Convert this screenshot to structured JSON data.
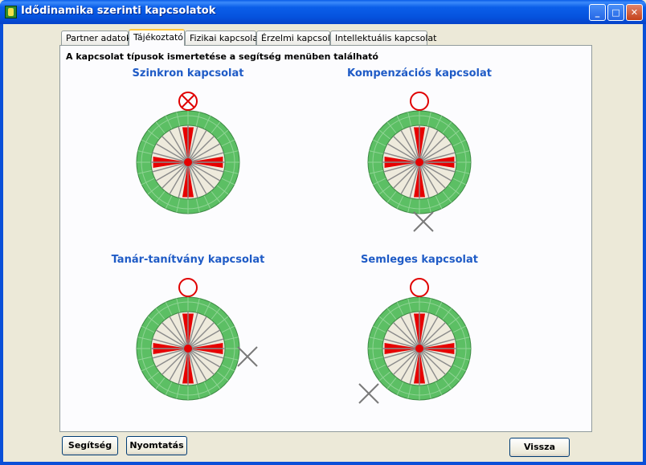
{
  "window": {
    "title": "Idődinamika szerinti kapcsolatok",
    "buttons": {
      "minimize": "_",
      "maximize": "□",
      "close": "✕"
    }
  },
  "tabs": [
    {
      "label": "Partner adatok",
      "active": false
    },
    {
      "label": "Tájékoztató",
      "active": true
    },
    {
      "label": "Fizikai kapcsolat",
      "active": false
    },
    {
      "label": "Érzelmi kapcsolat",
      "active": false
    },
    {
      "label": "Intellektuális kapcsolat",
      "active": false
    }
  ],
  "info_text": "A kapcsolat típusok ismertetése a segítség menüben található",
  "dials": [
    {
      "title": "Szinkron kapcsolat",
      "marker": "top-crossed"
    },
    {
      "title": "Kompenzációs kapcsolat",
      "marker": "top-circle-bottom-x"
    },
    {
      "title": "Tanár-tanítvány kapcsolat",
      "marker": "top-circle-right-x"
    },
    {
      "title": "Semleges kapcsolat",
      "marker": "top-circle-bottomleft-x"
    }
  ],
  "buttons": {
    "help": "Segítség",
    "print": "Nyomtatás",
    "back": "Vissza"
  },
  "colors": {
    "ring_green": "#5cbf64",
    "ring_dark": "#3d8a44",
    "inner_fill": "#eeeadc",
    "spoke": "#8a8a8a",
    "highlight": "#e60000",
    "marker_circle": "#e00000",
    "marker_x": "#7a7a7a",
    "title_blue": "#1f5bc6"
  }
}
